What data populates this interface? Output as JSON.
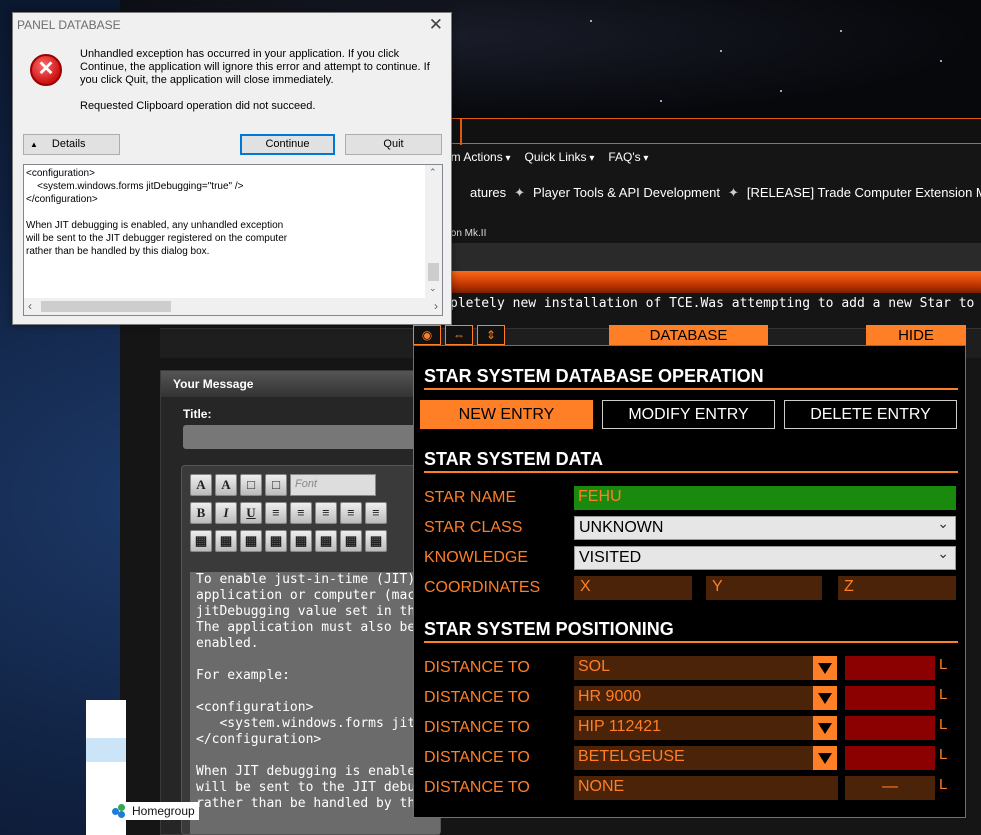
{
  "dialog": {
    "title": "PANEL DATABASE",
    "message": "Unhandled exception has occurred in your application. If you click Continue, the application will ignore this error and attempt to continue. If you click Quit, the application will close immediately.",
    "error": "Requested Clipboard operation did not succeed.",
    "details_label": "Details",
    "continue_label": "Continue",
    "quit_label": "Quit",
    "details_text": "<configuration>\n    <system.windows.forms jitDebugging=\"true\" />\n</configuration>\n\nWhen JIT debugging is enabled, any unhandled exception\nwill be sent to the JIT debugger registered on the computer\nrather than be handled by this dialog box."
  },
  "forum": {
    "nav": [
      "rum Actions",
      "Quick Links",
      "FAQ's"
    ],
    "breadcrumb": [
      "atures",
      "Player Tools & API Development",
      "[RELEASE] Trade Computer Extension Mk.II"
    ],
    "breadcrumb_sub": "nsion Mk.II",
    "excerpt": "pletely new installation of TCE.Was attempting to add a new Star to the datab",
    "panel_title": "Your Message",
    "title_label": "Title:",
    "font_placeholder": "Font",
    "editor_text": "To enable just-in-time (JIT) deb\napplication or computer (machi\njitDebugging value set in the sy\nThe application must also be co\nenabled.\n\nFor example:\n\n<configuration>\n   <system.windows.forms jitD\n</configuration>\n\nWhen JIT debugging is enabled,\nwill be sent to the JIT debugger\nrather than be handled by this"
  },
  "explorer": {
    "homegroup": "Homegroup"
  },
  "tce": {
    "top_bar": {
      "database": "DATABASE",
      "hide": "HIDE"
    },
    "section_operation": "STAR SYSTEM DATABASE OPERATION",
    "buttons": {
      "new": "NEW ENTRY",
      "modify": "MODIFY ENTRY",
      "delete": "DELETE ENTRY"
    },
    "section_data": "STAR SYSTEM DATA",
    "star_name_label": "STAR NAME",
    "star_name": "FEHU",
    "star_class_label": "STAR CLASS",
    "star_class": "UNKNOWN",
    "knowledge_label": "KNOWLEDGE",
    "knowledge": "VISITED",
    "coordinates_label": "COORDINATES",
    "coord_x": "X",
    "coord_y": "Y",
    "coord_z": "Z",
    "section_positioning": "STAR SYSTEM POSITIONING",
    "distance_label": "DISTANCE TO",
    "unit": "L",
    "distances": [
      "SOL",
      "HR 9000",
      "HIP 112421",
      "BETELGEUSE",
      "NONE"
    ],
    "none_value": "—",
    "colors": {
      "accent": "#ff7f27",
      "green": "#1a8a0e",
      "red": "#8b0000",
      "brown": "#4a2308"
    }
  }
}
